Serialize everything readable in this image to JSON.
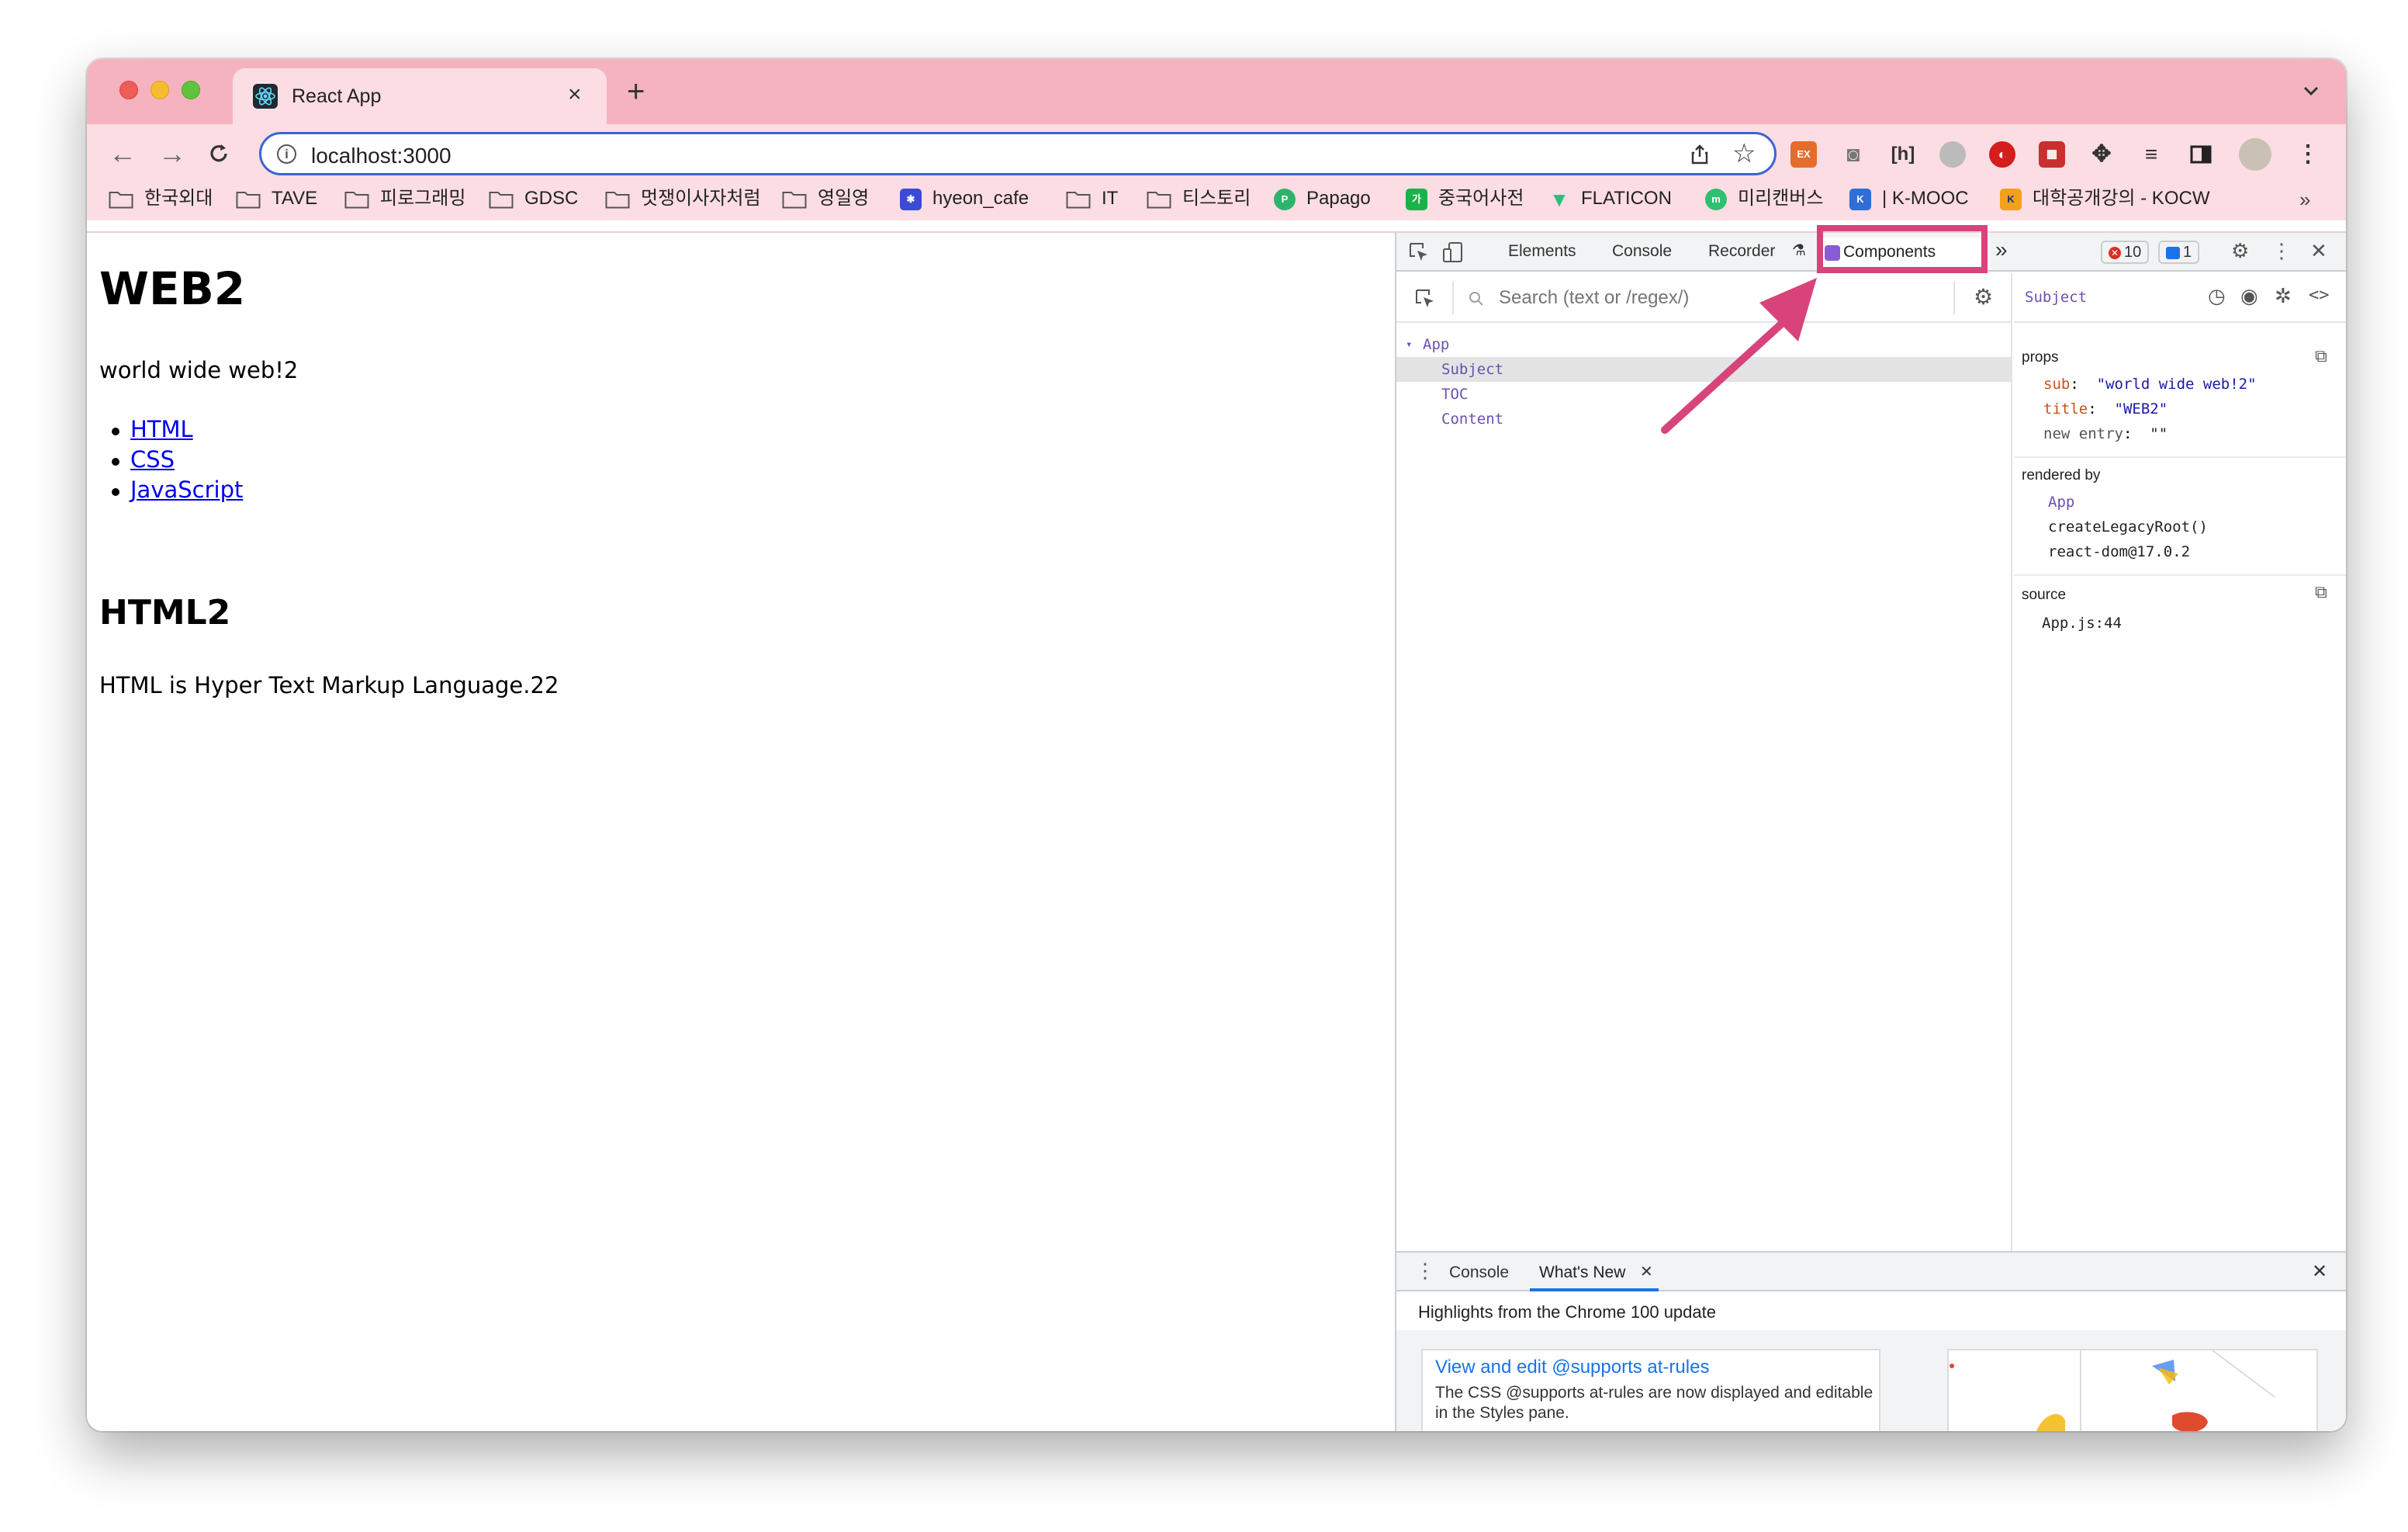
{
  "browser": {
    "tab_title": "React App",
    "tab_close": "×",
    "new_tab": "+",
    "url": "localhost:3000",
    "bookmarks": [
      {
        "label": "한국외대",
        "icon": "folder-icon"
      },
      {
        "label": "TAVE",
        "icon": "folder-icon"
      },
      {
        "label": "피로그래밍",
        "icon": "folder-icon"
      },
      {
        "label": "GDSC",
        "icon": "folder-icon"
      },
      {
        "label": "멋쟁이사자처럼",
        "icon": "folder-icon"
      },
      {
        "label": "영일영",
        "icon": "folder-icon"
      },
      {
        "label": "hyeon_cafe",
        "icon": "cafe-icon"
      },
      {
        "label": "IT",
        "icon": "folder-icon"
      },
      {
        "label": "티스토리",
        "icon": "folder-icon"
      },
      {
        "label": "Papago",
        "icon": "papago-icon"
      },
      {
        "label": "중국어사전",
        "icon": "dictionary-icon"
      },
      {
        "label": "FLATICON",
        "icon": "flaticon-icon"
      },
      {
        "label": "미리캔버스",
        "icon": "miricanvas-icon"
      },
      {
        "label": "| K-MOOC",
        "icon": "kmooc-icon"
      },
      {
        "label": "대학공개강의 - KOCW",
        "icon": "kocw-icon"
      }
    ],
    "more_bookmarks": "»"
  },
  "page": {
    "title": "WEB2",
    "subtitle": "world wide web!2",
    "links": [
      "HTML",
      "CSS",
      "JavaScript"
    ],
    "heading": "HTML2",
    "description": "HTML is Hyper Text Markup Language.22"
  },
  "devtools": {
    "tabs": [
      "Elements",
      "Console",
      "Recorder"
    ],
    "active_tab": "Components",
    "more_tabs": "»",
    "error_count": "10",
    "info_count": "1",
    "search_placeholder": "Search (text or /regex/)",
    "tree": {
      "root": "App",
      "children": [
        "Subject",
        "TOC",
        "Content"
      ],
      "selected": "Subject"
    },
    "inspector": {
      "component": "Subject",
      "props_title": "props",
      "props": [
        {
          "key": "sub",
          "value": "\"world wide web!2\""
        },
        {
          "key": "title",
          "value": "\"WEB2\""
        },
        {
          "key": "new entry",
          "value": "\"\""
        }
      ],
      "rendered_by_title": "rendered by",
      "rendered_by": [
        "App",
        "createLegacyRoot()",
        "react-dom@17.0.2"
      ],
      "source_title": "source",
      "source": "App.js:44"
    },
    "drawer": {
      "tabs": [
        "Console",
        "What's New"
      ],
      "active_tab": "What's New",
      "headline": "Highlights from the Chrome 100 update",
      "card_title": "View and edit @supports at-rules",
      "card_text": "The CSS @supports at-rules are now displayed and editable in the Styles pane."
    }
  },
  "colors": {
    "titlebar": "#f4b3bf",
    "toolbar": "#fbdde3",
    "annotation": "#d8437b",
    "link": "#0000ee",
    "react_purple": "#6a51b2"
  }
}
